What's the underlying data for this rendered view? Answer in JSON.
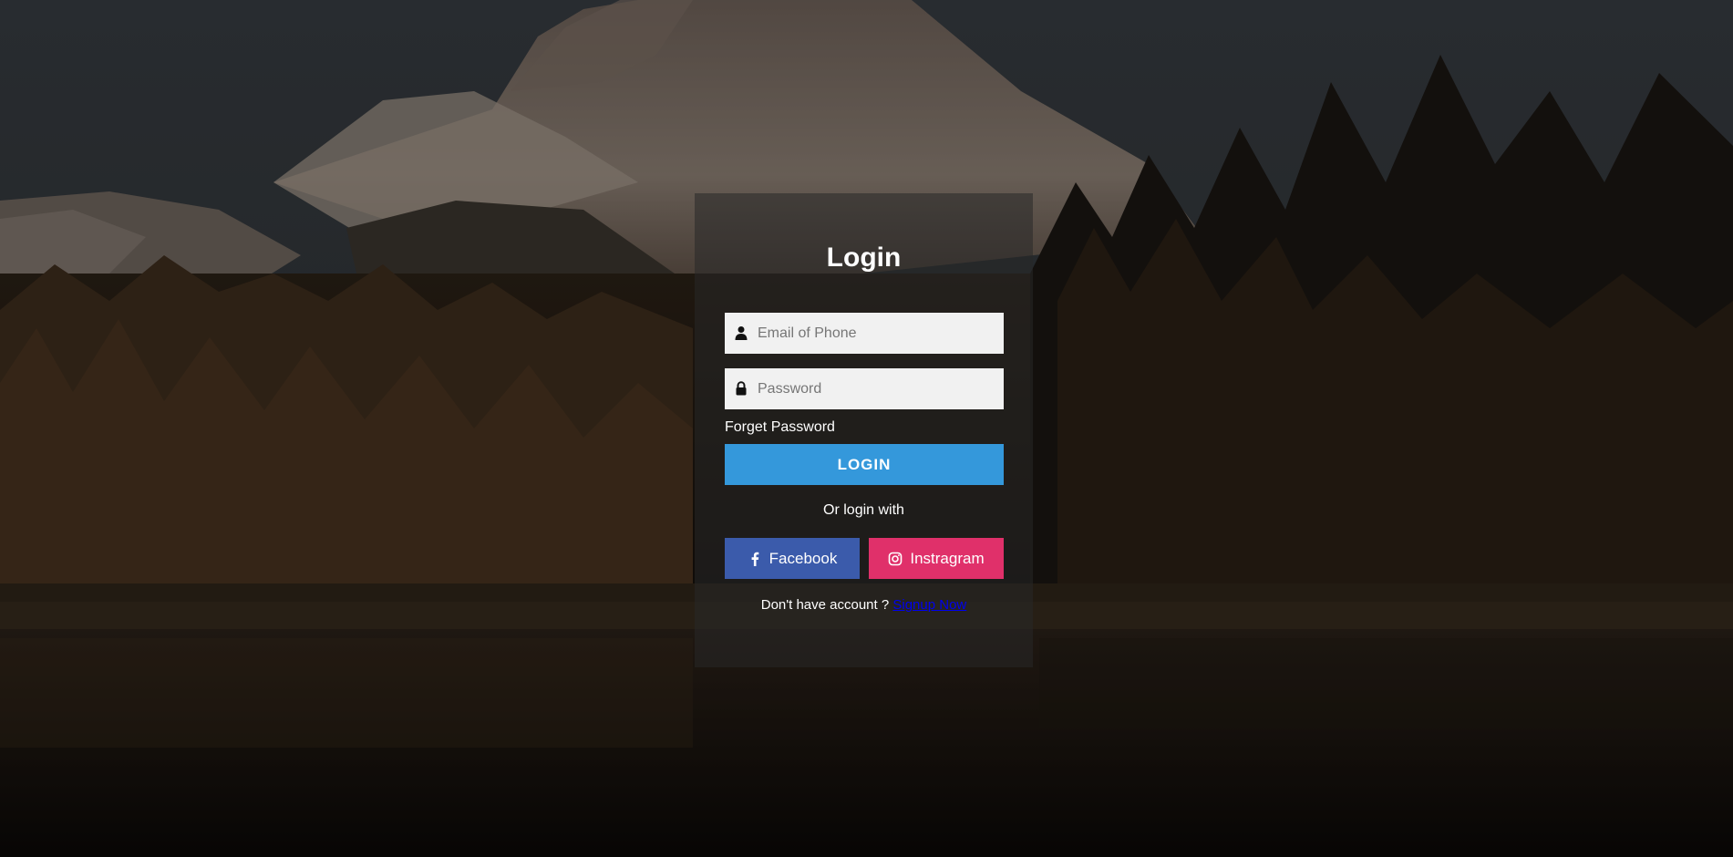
{
  "login": {
    "title": "Login",
    "email_placeholder": "Email of Phone",
    "password_placeholder": "Password",
    "forget_password": "Forget Password",
    "login_button": "LOGIN",
    "or_text": "Or login with",
    "facebook_label": "Facebook",
    "instagram_label": "Instragram",
    "no_account_text": "Don't have account ?",
    "signup_link": "Signup Now"
  },
  "icons": {
    "email": "user-icon",
    "password": "lock-icon",
    "facebook": "facebook-icon",
    "instagram": "instagram-icon"
  },
  "colors": {
    "login_button": "#3498db",
    "facebook": "#3b5bab",
    "instagram": "#e0306a",
    "input_bg": "#f1f1f1"
  }
}
